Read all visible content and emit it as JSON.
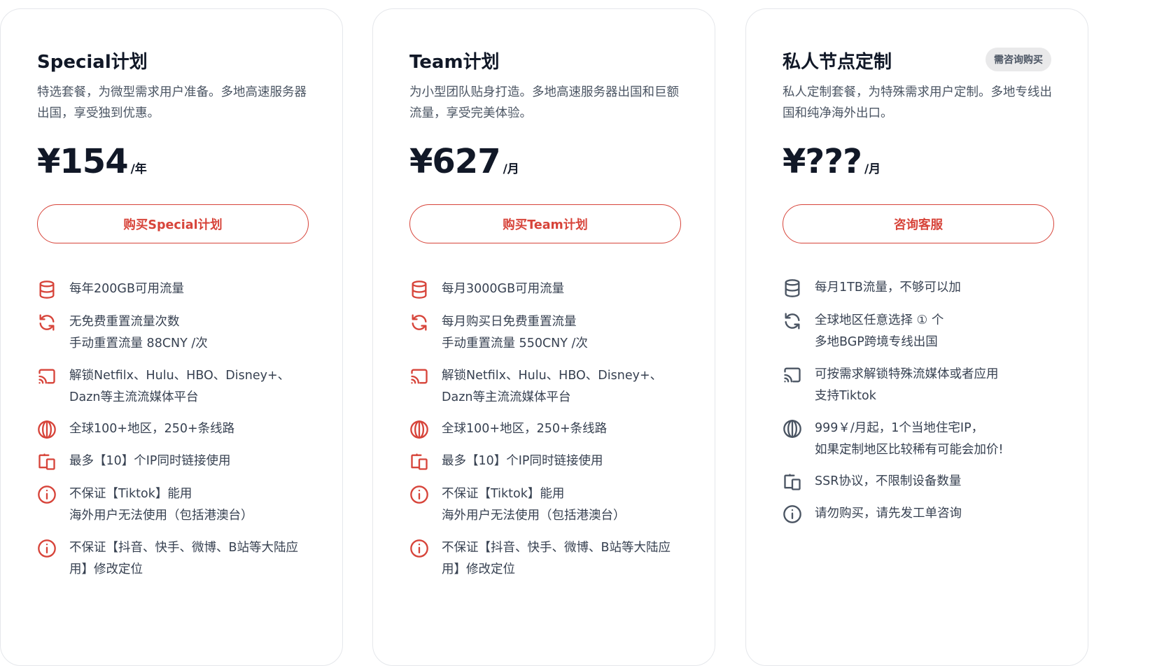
{
  "accent_color": "#d7443a",
  "plans": [
    {
      "title": "Special计划",
      "description": "特选套餐，为微型需求用户准备。多地高速服务器出国，享受独到优惠。",
      "price": "¥154",
      "period": "/年",
      "button": "购买Special计划",
      "features": [
        {
          "icon": "database-icon",
          "lines": [
            "每年200GB可用流量"
          ]
        },
        {
          "icon": "refresh-icon",
          "lines": [
            "无免费重置流量次数",
            "手动重置流量 88CNY /次"
          ]
        },
        {
          "icon": "cast-icon",
          "lines": [
            "解锁Netfilx、Hulu、HBO、Disney+、",
            "Dazn等主流流媒体平台"
          ]
        },
        {
          "icon": "globe-icon",
          "lines": [
            "全球100+地区，250+条线路"
          ]
        },
        {
          "icon": "devices-icon",
          "lines": [
            "最多【10】个IP同时链接使用"
          ]
        },
        {
          "icon": "info-icon",
          "lines": [
            "不保证【Tiktok】能用",
            "海外用户无法使用（包括港澳台）"
          ]
        },
        {
          "icon": "info-icon",
          "lines": [
            "不保证【抖音、快手、微博、B站等大陆应",
            "用】修改定位"
          ]
        }
      ]
    },
    {
      "title": "Team计划",
      "description": "为小型团队贴身打造。多地高速服务器出国和巨额流量，享受完美体验。",
      "price": "¥627",
      "period": "/月",
      "button": "购买Team计划",
      "features": [
        {
          "icon": "database-icon",
          "lines": [
            "每月3000GB可用流量"
          ]
        },
        {
          "icon": "refresh-icon",
          "lines": [
            "每月购买日免费重置流量",
            "手动重置流量 550CNY /次"
          ]
        },
        {
          "icon": "cast-icon",
          "lines": [
            "解锁Netfilx、Hulu、HBO、Disney+、",
            "Dazn等主流流媒体平台"
          ]
        },
        {
          "icon": "globe-icon",
          "lines": [
            "全球100+地区，250+条线路"
          ]
        },
        {
          "icon": "devices-icon",
          "lines": [
            "最多【10】个IP同时链接使用"
          ]
        },
        {
          "icon": "info-icon",
          "lines": [
            "不保证【Tiktok】能用",
            "海外用户无法使用（包括港澳台）"
          ]
        },
        {
          "icon": "info-icon",
          "lines": [
            "不保证【抖音、快手、微博、B站等大陆应",
            "用】修改定位"
          ]
        }
      ]
    },
    {
      "title": "私人节点定制",
      "badge": "需咨询购买",
      "description": "私人定制套餐，为特殊需求用户定制。多地专线出国和纯净海外出口。",
      "price": "¥???",
      "period": "/月",
      "button": "咨询客服",
      "features": [
        {
          "icon": "database-icon",
          "lines": [
            "每月1TB流量，不够可以加"
          ]
        },
        {
          "icon": "refresh-icon",
          "lines": [
            "全球地区任意选择 ① 个",
            "多地BGP跨境专线出国"
          ]
        },
        {
          "icon": "cast-icon",
          "lines": [
            "可按需求解锁特殊流媒体或者应用",
            "支持Tiktok"
          ]
        },
        {
          "icon": "globe-icon",
          "lines": [
            "999￥/月起，1个当地住宅IP，",
            "如果定制地区比较稀有可能会加价!"
          ]
        },
        {
          "icon": "devices-icon",
          "lines": [
            "SSR协议，不限制设备数量"
          ]
        },
        {
          "icon": "info-icon",
          "lines": [
            "请勿购买，请先发工单咨询"
          ]
        }
      ]
    }
  ]
}
